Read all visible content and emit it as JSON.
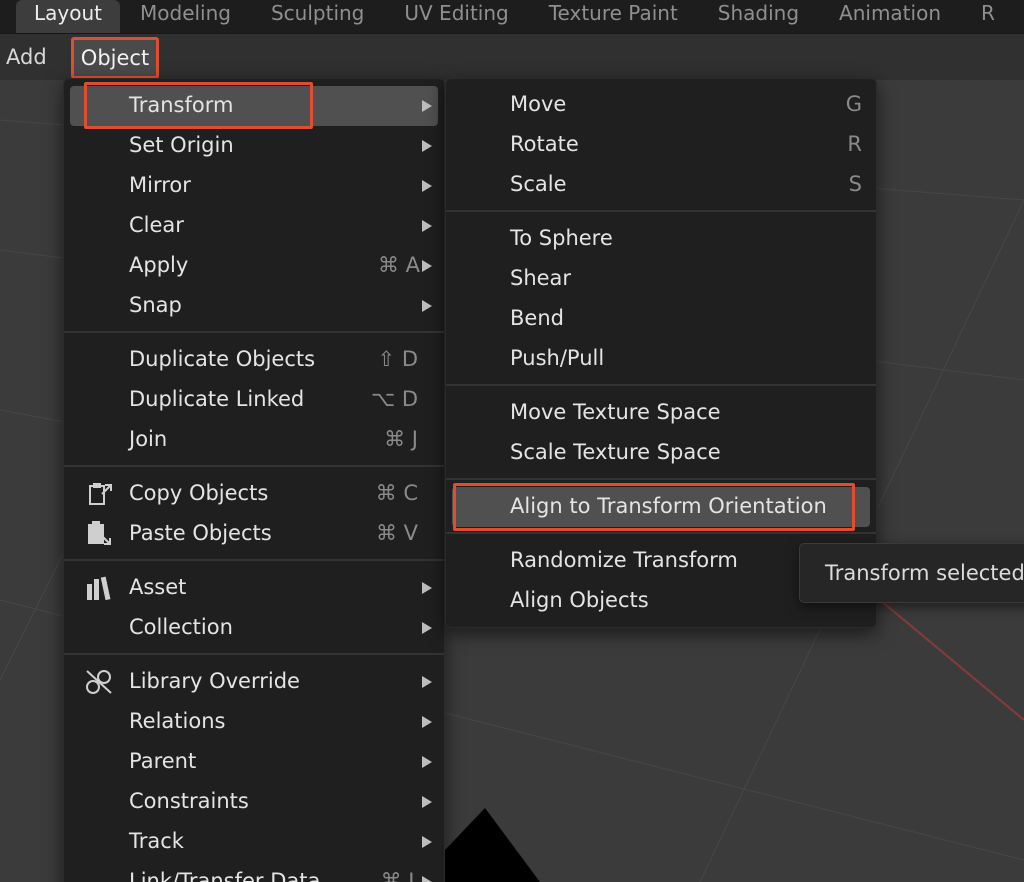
{
  "workspaces": {
    "tabs": [
      "Layout",
      "Modeling",
      "Sculpting",
      "UV Editing",
      "Texture Paint",
      "Shading",
      "Animation",
      "R"
    ]
  },
  "header": {
    "add_label": "Add",
    "object_label": "Object"
  },
  "object_menu": {
    "items": [
      {
        "label": "Transform",
        "shortcut": ""
      },
      {
        "label": "Set Origin",
        "shortcut": ""
      },
      {
        "label": "Mirror",
        "shortcut": ""
      },
      {
        "label": "Clear",
        "shortcut": ""
      },
      {
        "label": "Apply",
        "shortcut": "⌘ A"
      },
      {
        "label": "Snap",
        "shortcut": ""
      },
      {
        "label": "Duplicate Objects",
        "shortcut": "⇧ D"
      },
      {
        "label": "Duplicate Linked",
        "shortcut": "⌥ D"
      },
      {
        "label": "Join",
        "shortcut": "⌘ J"
      },
      {
        "label": "Copy Objects",
        "shortcut": "⌘ C"
      },
      {
        "label": "Paste Objects",
        "shortcut": "⌘ V"
      },
      {
        "label": "Asset",
        "shortcut": ""
      },
      {
        "label": "Collection",
        "shortcut": ""
      },
      {
        "label": "Library Override",
        "shortcut": ""
      },
      {
        "label": "Relations",
        "shortcut": ""
      },
      {
        "label": "Parent",
        "shortcut": ""
      },
      {
        "label": "Constraints",
        "shortcut": ""
      },
      {
        "label": "Track",
        "shortcut": ""
      },
      {
        "label": "Link/Transfer Data",
        "shortcut": "⌘ L"
      }
    ]
  },
  "transform_menu": {
    "items": [
      {
        "label": "Move",
        "shortcut": "G"
      },
      {
        "label": "Rotate",
        "shortcut": "R"
      },
      {
        "label": "Scale",
        "shortcut": "S"
      },
      {
        "label": "To Sphere",
        "shortcut": ""
      },
      {
        "label": "Shear",
        "shortcut": ""
      },
      {
        "label": "Bend",
        "shortcut": ""
      },
      {
        "label": "Push/Pull",
        "shortcut": ""
      },
      {
        "label": "Move Texture Space",
        "shortcut": ""
      },
      {
        "label": "Scale Texture Space",
        "shortcut": ""
      },
      {
        "label": "Align to Transform Orientation",
        "shortcut": ""
      },
      {
        "label": "Randomize Transform",
        "shortcut": ""
      },
      {
        "label": "Align Objects",
        "shortcut": ""
      }
    ]
  },
  "tooltip": {
    "text": "Transform selected"
  },
  "colors": {
    "highlight_outline": "#e04e2f",
    "menu_bg": "#1f1f1f",
    "item_hover": "#505050"
  }
}
